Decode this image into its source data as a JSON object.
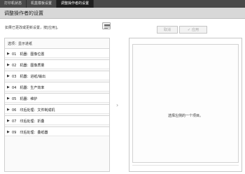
{
  "tabs": [
    {
      "label": "打印机状态"
    },
    {
      "label": "机盒模板设置"
    },
    {
      "label": "调整操作者的设置"
    }
  ],
  "header": {
    "title": "调整操作者的设置"
  },
  "hint": "如果已更改或更新设置，按[应用]。",
  "actions": {
    "cancel_label": "取消",
    "apply_label": "应用"
  },
  "settings": {
    "current_label": "选项：显示进纸",
    "items": [
      {
        "label": "01　机器：图像位置"
      },
      {
        "label": "02　机器：图像质量"
      },
      {
        "label": "03　机器：进纸/输出"
      },
      {
        "label": "04　机器：生产效率"
      },
      {
        "label": "05　机器：维护"
      },
      {
        "label": "06　印后处理：文件制成机"
      },
      {
        "label": "07　印后处理：折叠"
      },
      {
        "label": "09　印后处理：叠纸器"
      }
    ]
  },
  "detail": {
    "message": "选择左侧的一个项目。"
  }
}
